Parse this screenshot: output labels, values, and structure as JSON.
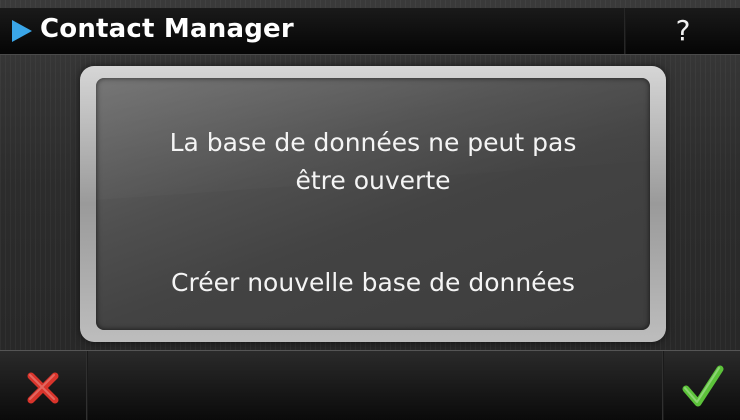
{
  "titlebar": {
    "title": "Contact Manager",
    "help_label": "?",
    "arrow_icon": "play-arrow-icon",
    "arrow_color": "#3aa6e8"
  },
  "dialog": {
    "message_line1": "La base de données ne peut pas",
    "message_line2": "être ouverte",
    "action_label": "Créer nouvelle base de données"
  },
  "bottombar": {
    "cancel_icon": "close-x-icon",
    "cancel_color": "#d9342b",
    "confirm_icon": "checkmark-icon",
    "confirm_color": "#5cc23a"
  }
}
